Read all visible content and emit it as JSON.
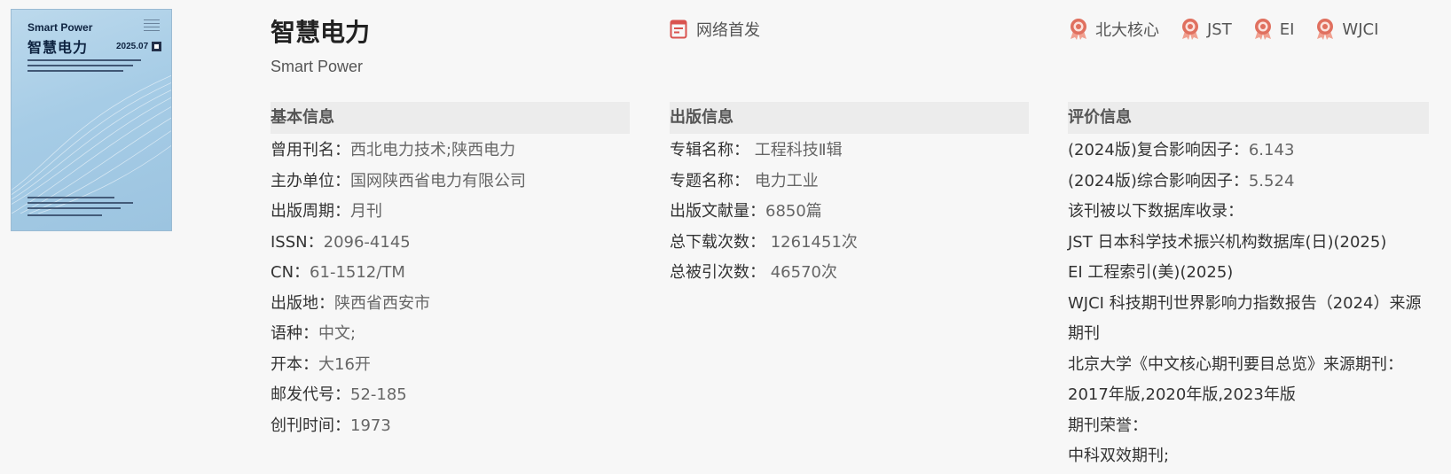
{
  "cover": {
    "title_en": "Smart Power",
    "title_cn": "智慧电力",
    "issue": "2025.07"
  },
  "journal": {
    "title_cn": "智慧电力",
    "title_en": "Smart Power"
  },
  "network_first": "网络首发",
  "badges": [
    "北大核心",
    "JST",
    "EI",
    "WJCI"
  ],
  "basic_info": {
    "heading": "基本信息",
    "rows": [
      {
        "k": "曾用刊名：",
        "v": "西北电力技术;陕西电力"
      },
      {
        "k": "主办单位：",
        "v": "国网陕西省电力有限公司"
      },
      {
        "k": "出版周期：",
        "v": "月刊"
      },
      {
        "k": "ISSN：",
        "v": "2096-4145"
      },
      {
        "k": "CN：",
        "v": "61-1512/TM"
      },
      {
        "k": "出版地：",
        "v": "陕西省西安市"
      },
      {
        "k": "语种：",
        "v": "中文;"
      },
      {
        "k": "开本：",
        "v": "大16开"
      },
      {
        "k": "邮发代号：",
        "v": "52-185"
      },
      {
        "k": "创刊时间：",
        "v": "1973"
      }
    ]
  },
  "publish_info": {
    "heading": "出版信息",
    "rows": [
      {
        "k": "专辑名称：",
        "v": "工程科技Ⅱ辑"
      },
      {
        "k": "专题名称：",
        "v": "电力工业"
      },
      {
        "k": "出版文献量：",
        "v": "6850篇"
      },
      {
        "k": "总下载次数：",
        "v": "1261451次"
      },
      {
        "k": "总被引次数：",
        "v": "46570次"
      }
    ]
  },
  "eval_info": {
    "heading": "评价信息",
    "impact_composite": {
      "k": "(2024版)复合影响因子：",
      "v": "6.143"
    },
    "impact_overall": {
      "k": "(2024版)综合影响因子：",
      "v": "5.524"
    },
    "db_label": "该刊被以下数据库收录：",
    "databases": [
      "JST 日本科学技术振兴机构数据库(日)(2025)",
      "EI 工程索引(美)(2025)",
      "WJCI 科技期刊世界影响力指数报告（2024）来源期刊"
    ],
    "pku_label": "北京大学《中文核心期刊要目总览》来源期刊：",
    "pku_value": "2017年版,2020年版,2023年版",
    "honor_label": "期刊荣誉：",
    "honor_value": "中科双效期刊;"
  },
  "colors": {
    "badge": "#e0705f",
    "netfirst": "#d9534f"
  }
}
